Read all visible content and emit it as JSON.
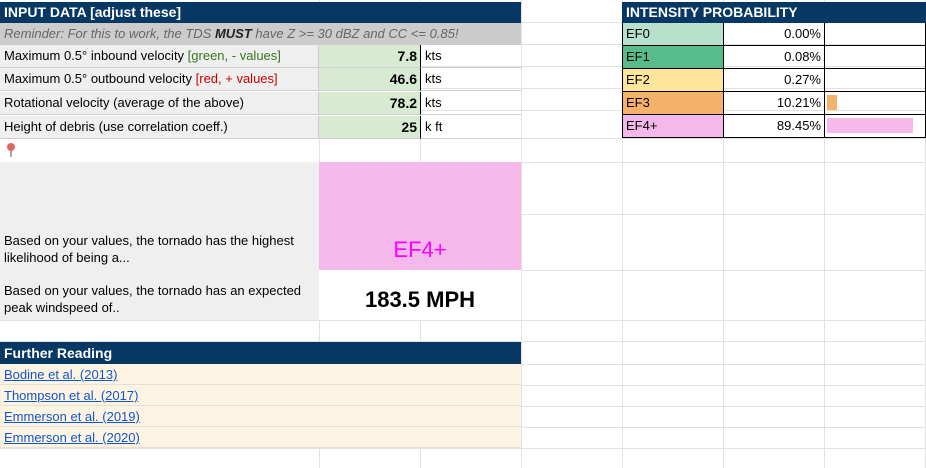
{
  "input": {
    "header": "INPUT DATA [adjust these]",
    "reminder_pre": "Reminder: For this to work, the TDS ",
    "reminder_bold": "MUST",
    "reminder_post": " have Z >= 30 dBZ and CC <= 0.85!",
    "rows": [
      {
        "label": "Maximum 0.5° inbound velocity ",
        "note": "[green, - values]",
        "note_color": "#38761d",
        "value": "7.8",
        "unit": "kts"
      },
      {
        "label": "Maximum 0.5° outbound velocity ",
        "note": "[red, + values]",
        "note_color": "#cc0000",
        "value": "46.6",
        "unit": "kts"
      },
      {
        "label": "Rotational velocity (average of the above)",
        "note": "",
        "note_color": "",
        "value": "78.2",
        "unit": "kts"
      },
      {
        "label": "Height of debris (use correlation coeff.)",
        "note": "",
        "note_color": "",
        "value": "25",
        "unit": "k ft"
      }
    ]
  },
  "intensity": {
    "header": "INTENSITY PROBABILITY",
    "rows": [
      {
        "label": "EF0",
        "pct": "0.00%",
        "fraction": 0.0,
        "color": "#b7e1cd"
      },
      {
        "label": "EF1",
        "pct": "0.08%",
        "fraction": 0.0008,
        "color": "#57bb8a"
      },
      {
        "label": "EF2",
        "pct": "0.27%",
        "fraction": 0.0027,
        "color": "#ffe599"
      },
      {
        "label": "EF3",
        "pct": "10.21%",
        "fraction": 0.1021,
        "color": "#f6b26b"
      },
      {
        "label": "EF4+",
        "pct": "89.45%",
        "fraction": 0.8945,
        "color": "#f4b8ea"
      }
    ]
  },
  "result": {
    "likelihood_label": "Based on your values, the tornado has the highest likelihood of being a...",
    "likelihood_value": "EF4+",
    "likelihood_color": "#ff00ff",
    "likelihood_bg": "#f4b8ea",
    "wind_label": "Based on your values, the tornado has an expected peak windspeed of..",
    "wind_value": "183.5 MPH"
  },
  "reading": {
    "header": "Further Reading",
    "links": [
      "Bodine et al. (2013)",
      "Thompson et al. (2017)",
      "Emmerson et al. (2019)",
      "Emmerson et al. (2020)"
    ]
  },
  "icons": {
    "pin": "pushpin-icon"
  }
}
